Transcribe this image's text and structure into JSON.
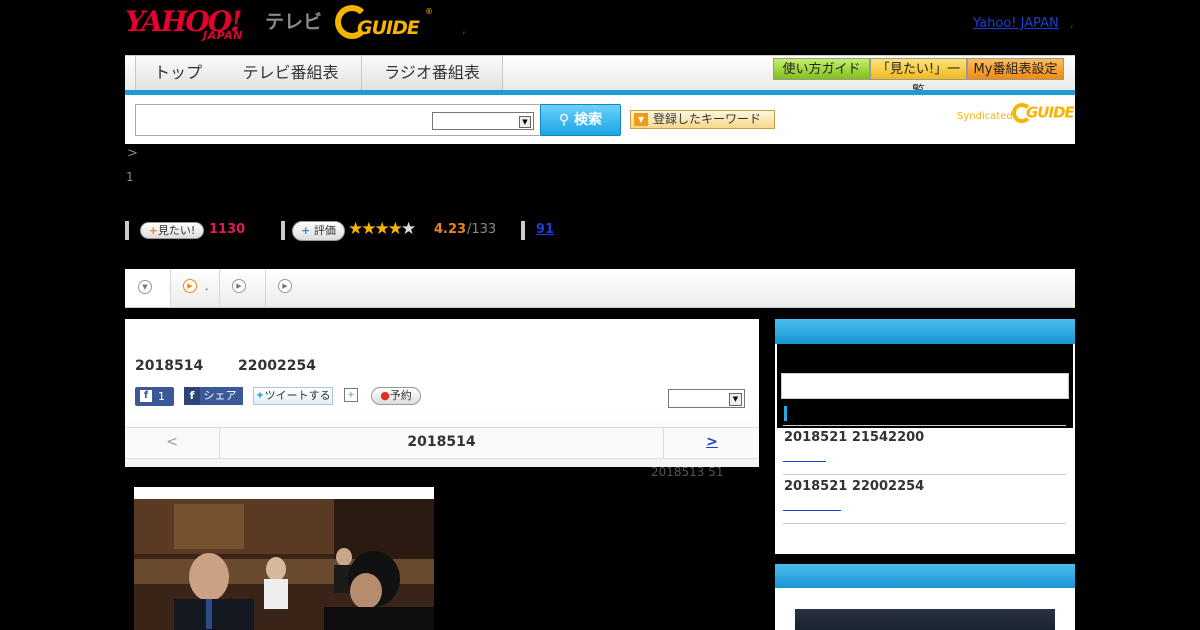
{
  "header": {
    "yahoo_logo": "YAHOO!",
    "yahoo_logo_sub": "JAPAN",
    "tv_label": "テレビ",
    "gguide_logo": "GUIDE",
    "gguide_mark": "®",
    "dot": ",",
    "yahoo_japan_link": "Yahoo! JAPAN",
    "yj_dot": ","
  },
  "nav": {
    "tabs": [
      "トップ",
      "テレビ番組表",
      "ラジオ番組表"
    ],
    "guide_button": "使い方ガイド",
    "mitai_list_button": "「見たい!」一覧",
    "my_schedule_button": "My番組表設定"
  },
  "search": {
    "input_value": "",
    "select_value": "",
    "search_button": "検索",
    "keyword_button": "登録したキーワード",
    "syndicated_label": "Syndicated",
    "syndicated_logo": "GUIDE"
  },
  "breadcrumb": {
    "arrow": ">",
    "line2": "1"
  },
  "rating": {
    "mitai_button": "見たい!",
    "mitai_count": "1130",
    "hyoka_button": "評価",
    "stars_filled": 4,
    "score": "4.23",
    "score_count": "/133",
    "reviews_link": "91"
  },
  "subtabs": {
    "tab2_label": "."
  },
  "episode": {
    "air_date": "2018514",
    "air_time": "22002254",
    "fb_like_count": "1",
    "fb_share_label": "シェア",
    "tweet_label": "ツイートする",
    "reserve_label": "予約",
    "select_value": "",
    "prev_label": "<",
    "title": "2018514",
    "next_label": ">",
    "updated": "2018513  51"
  },
  "sidebar": {
    "items": [
      {
        "date": "2018521  21542200"
      },
      {
        "date": "2018521  22002254"
      }
    ]
  },
  "colors": {
    "accent_blue": "#1e9bd7",
    "link": "#1a3fd6",
    "mitai_pink": "#e2195f",
    "score_orange": "#f0821e",
    "star_gold": "#f4b400"
  }
}
